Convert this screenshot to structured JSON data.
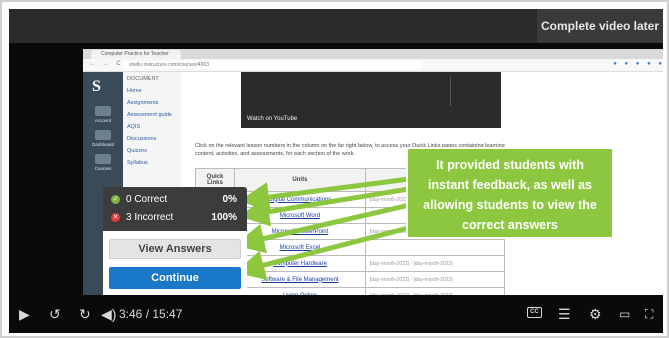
{
  "player": {
    "complete_later_label": "Complete video later",
    "time_current": "3:46",
    "time_total": "15:47",
    "time_separator": " / "
  },
  "embedded_page": {
    "browser_tab_title": "Computer Practice for Teacher",
    "url": "shello.instructure.com/courses/4903",
    "logo": "S",
    "account_label": "Account",
    "dashboard_label": "Dashboard",
    "courses_label": "Courses",
    "course_nav": [
      "Home",
      "Assignments",
      "Assessment guide",
      "AQIS",
      "Discussions",
      "Quizzes",
      "Syllabus"
    ],
    "course_title": "DOCUMENT",
    "video_watch_label": "Watch on YouTube",
    "instructions": "Click on the relevant lesson numbers in the column on the far right below, to access your Quick Links pages containing learning content, activities, and assessments, for each section of the work.",
    "table_headers": [
      "Quick Links",
      "Units",
      ""
    ],
    "units": [
      {
        "name": "Digital Communications",
        "dates": "[day-month-2022]"
      },
      {
        "name": "Microsoft Word",
        "dates": ""
      },
      {
        "name": "Microsoft PowerPoint",
        "dates": "[day-month-2022]"
      },
      {
        "name": "Microsoft Excel",
        "dates": ""
      },
      {
        "name": "Computer Hardware",
        "dates": "[day-month-2022] - [day-month-2022]"
      },
      {
        "name": "Software & File Management",
        "dates": "[day-month-2022] - [day-month-2022]"
      },
      {
        "name": "Living Online",
        "dates": "[day-month-2022] - [day-month-2022]"
      }
    ]
  },
  "quiz_feedback": {
    "correct_label": "0 Correct",
    "correct_pct": "0%",
    "incorrect_label": "3 Incorrect",
    "incorrect_pct": "100%",
    "view_answers_label": "View Answers",
    "continue_label": "Continue"
  },
  "callout": {
    "lines": [
      "It provided students with",
      "instant feedback, as well as",
      "allowing students to view the",
      "correct answers"
    ]
  },
  "colors": {
    "callout_green": "#8dc63f",
    "continue_blue": "#1a78c8",
    "correct_green": "#7cb342",
    "incorrect_red": "#e53935"
  }
}
